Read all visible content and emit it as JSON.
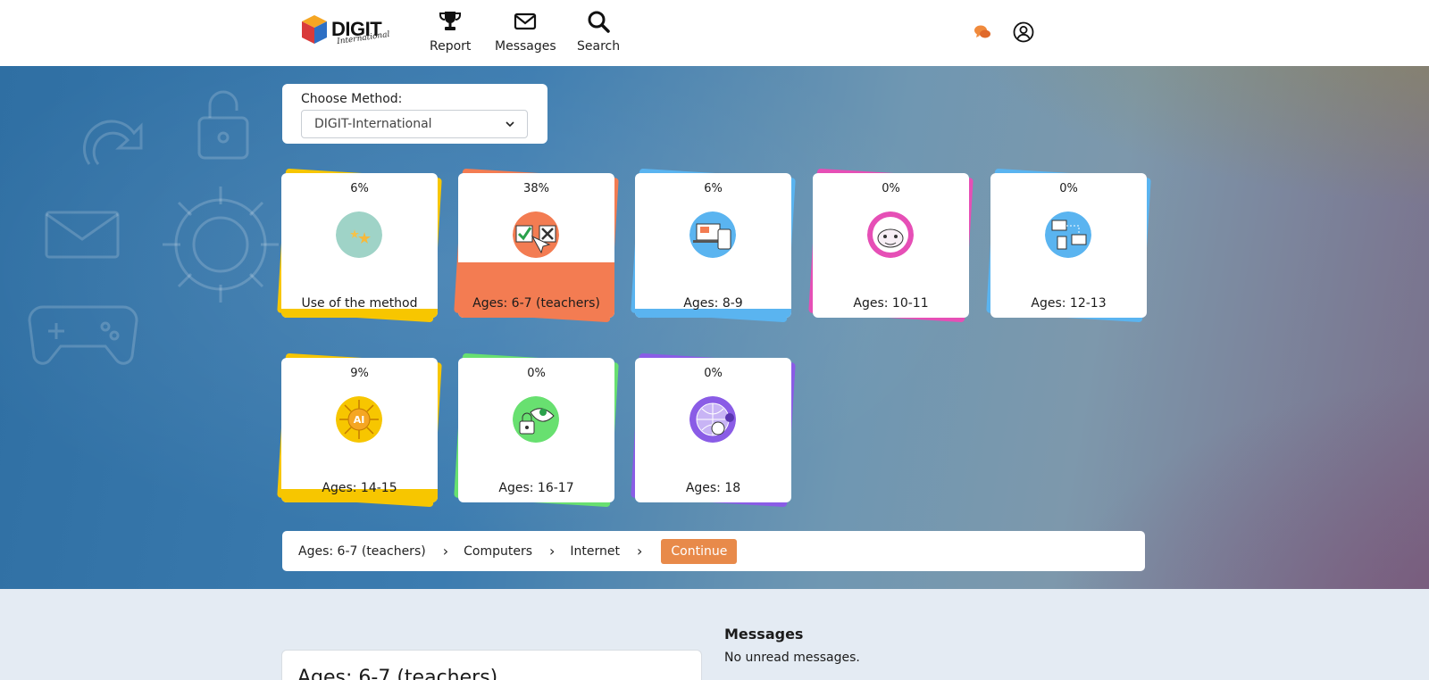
{
  "header": {
    "logo_text": "DIGIT",
    "logo_sub": "International",
    "nav": [
      {
        "label": "Report",
        "icon": "trophy-icon"
      },
      {
        "label": "Messages",
        "icon": "envelope-icon"
      },
      {
        "label": "Search",
        "icon": "search-icon"
      }
    ],
    "chat_icon": "chat-bubbles-icon",
    "user_icon": "user-circle-icon"
  },
  "method": {
    "label": "Choose Method:",
    "selected": "DIGIT-International"
  },
  "cards": [
    {
      "pct": "6%",
      "title": "Use of the method",
      "color": "#f7c600",
      "progress": 6
    },
    {
      "pct": "38%",
      "title": "Ages: 6-7 (teachers)",
      "color": "#f37c52",
      "progress": 38
    },
    {
      "pct": "6%",
      "title": "Ages: 8-9",
      "color": "#5ab4f0",
      "progress": 6
    },
    {
      "pct": "0%",
      "title": "Ages: 10-11",
      "color": "#e64fb6",
      "progress": 0
    },
    {
      "pct": "0%",
      "title": "Ages: 12-13",
      "color": "#5ab4f0",
      "progress": 0
    },
    {
      "pct": "9%",
      "title": "Ages: 14-15",
      "color": "#f7c600",
      "progress": 9
    },
    {
      "pct": "0%",
      "title": "Ages: 16-17",
      "color": "#68e070",
      "progress": 0
    },
    {
      "pct": "0%",
      "title": "Ages: 18",
      "color": "#8a5ce6",
      "progress": 0
    }
  ],
  "breadcrumb": {
    "items": [
      "Ages: 6-7 (teachers)",
      "Computers",
      "Internet"
    ],
    "continue_label": "Continue"
  },
  "bottom": {
    "card_title": "Ages: 6-7 (teachers)",
    "messages_title": "Messages",
    "messages_text": "No unread messages."
  }
}
